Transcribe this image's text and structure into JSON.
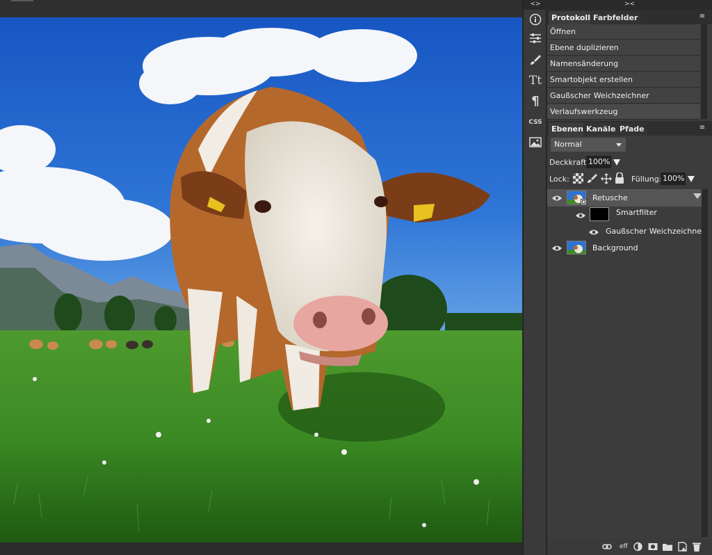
{
  "canvas": {
    "description": ""
  },
  "tool_column": {
    "collapse_glyph": "<>",
    "tools": [
      {
        "name": "info-icon"
      },
      {
        "name": "adjustments-icon"
      },
      {
        "name": "brush-icon"
      },
      {
        "name": "type-icon",
        "glyph": "Tt"
      },
      {
        "name": "paragraph-icon",
        "glyph": "¶"
      },
      {
        "name": "css-icon",
        "glyph": "CSS"
      },
      {
        "name": "image-icon"
      }
    ]
  },
  "right_panel": {
    "collapse_glyph": "><",
    "history_tabs": [
      {
        "label": "Protokoll",
        "active": true
      },
      {
        "label": "Farbfelder",
        "active": false
      }
    ],
    "history_items": [
      "Öffnen",
      "Ebene duplizieren",
      "Namensänderung",
      "Smartobjekt erstellen",
      "Gaußscher Weichzeichner",
      "Verlaufswerkzeug"
    ],
    "layer_tabs": [
      {
        "label": "Ebenen",
        "active": true
      },
      {
        "label": "Kanäle",
        "active": false
      },
      {
        "label": "Pfade",
        "active": false
      }
    ],
    "blend_mode": "Normal",
    "opacity_label": "Deckkraft:",
    "opacity_value": "100%",
    "lock_label": "Lock:",
    "fill_label": "Füllung:",
    "fill_value": "100%",
    "layers": [
      {
        "name": "Retusche",
        "selected": true
      },
      {
        "name": "Smartfilter"
      },
      {
        "name": "Gaußscher Weichzeichner"
      },
      {
        "name": "Background"
      }
    ],
    "footer_icons": [
      "link-icon",
      "effects-icon",
      "adjustment-layer-icon",
      "mask-icon",
      "folder-icon",
      "new-layer-icon",
      "trash-icon"
    ],
    "footer_eff_label": "eff"
  },
  "colors": {
    "panel_bg": "#3c3c3c",
    "sky": "#1f5fc4",
    "grass": "#3f8c2a"
  }
}
